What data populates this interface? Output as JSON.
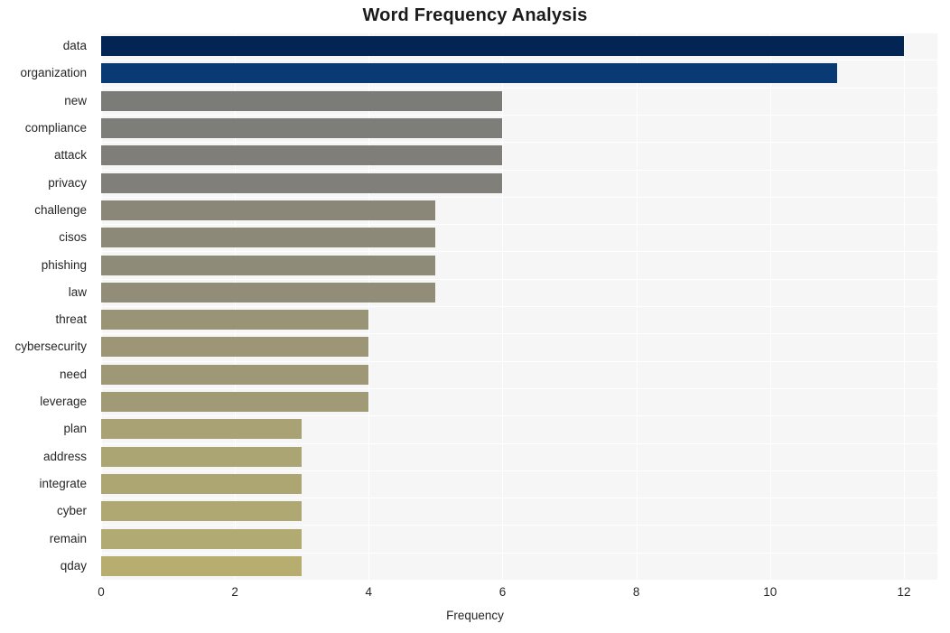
{
  "chart_data": {
    "type": "bar",
    "orientation": "horizontal",
    "title": "Word Frequency Analysis",
    "xlabel": "Frequency",
    "ylabel": "",
    "categories": [
      "data",
      "organization",
      "new",
      "compliance",
      "attack",
      "privacy",
      "challenge",
      "cisos",
      "phishing",
      "law",
      "threat",
      "cybersecurity",
      "need",
      "leverage",
      "plan",
      "address",
      "integrate",
      "cyber",
      "remain",
      "qday"
    ],
    "values": [
      12,
      11,
      6,
      6,
      6,
      6,
      5,
      5,
      5,
      5,
      4,
      4,
      4,
      4,
      3,
      3,
      3,
      3,
      3,
      3
    ],
    "bar_colors": [
      "#032554",
      "#0a3a74",
      "#7b7b78",
      "#7d7d79",
      "#7f7e79",
      "#817f79",
      "#8a8779",
      "#8c8979",
      "#8f8b79",
      "#918d78",
      "#9a9477",
      "#9c9676",
      "#9e9876",
      "#a09a76",
      "#a9a274",
      "#aba473",
      "#ada673",
      "#afa872",
      "#b1aa72",
      "#b6ad6f"
    ],
    "xticks": [
      0,
      2,
      4,
      6,
      8,
      10,
      12
    ],
    "xtick_labels": [
      "0",
      "2",
      "4",
      "6",
      "8",
      "10",
      "12"
    ],
    "xlim": [
      0,
      12.5
    ],
    "grid": true,
    "legend": "none",
    "plot_background": "#f6f6f6",
    "gridline_color": "#ffffff",
    "figure_background": "#ffffff"
  }
}
